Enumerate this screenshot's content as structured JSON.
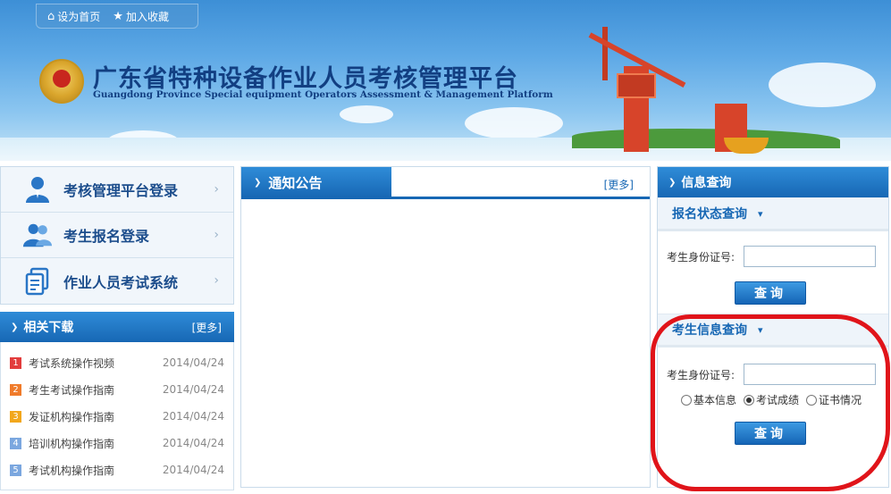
{
  "header": {
    "toplinks": [
      {
        "label": "设为首页",
        "icon": "home-icon"
      },
      {
        "label": "加入收藏",
        "icon": "star-icon"
      }
    ],
    "title_cn": "广东省特种设备作业人员考核管理平台",
    "title_en": "Guangdong Province Special equipment Operators Assessment & Management Platform"
  },
  "login_links": [
    {
      "label": "考核管理平台登录",
      "icon": "user-icon"
    },
    {
      "label": "考生报名登录",
      "icon": "users-icon"
    },
    {
      "label": "作业人员考试系统",
      "icon": "document-icon"
    }
  ],
  "downloads": {
    "title": "相关下载",
    "more": "[更多]",
    "items": [
      {
        "num": "1",
        "title": "考试系统操作视频",
        "date": "2014/04/24",
        "color": "#e23c3c"
      },
      {
        "num": "2",
        "title": "考生考试操作指南",
        "date": "2014/04/24",
        "color": "#f07b2a"
      },
      {
        "num": "3",
        "title": "发证机构操作指南",
        "date": "2014/04/24",
        "color": "#f2a71c"
      },
      {
        "num": "4",
        "title": "培训机构操作指南",
        "date": "2014/04/24",
        "color": "#7ba7df"
      },
      {
        "num": "5",
        "title": "考试机构操作指南",
        "date": "2014/04/24",
        "color": "#7ba7df"
      }
    ]
  },
  "notice": {
    "title": "通知公告",
    "more": "[更多]"
  },
  "info_query": {
    "title": "信息查询",
    "reg_status": {
      "title": "报名状态查询",
      "id_label": "考生身份证号:",
      "id_value": "",
      "button": "查询"
    },
    "candidate_info": {
      "title": "考生信息查询",
      "id_label": "考生身份证号:",
      "id_value": "",
      "options": [
        {
          "label": "基本信息",
          "selected": false
        },
        {
          "label": "考试成绩",
          "selected": true
        },
        {
          "label": "证书情况",
          "selected": false
        }
      ],
      "button": "查询"
    }
  },
  "colors": {
    "brand_blue": "#1767b4",
    "title_navy": "#123f82",
    "annotation_red": "#e0141a"
  }
}
